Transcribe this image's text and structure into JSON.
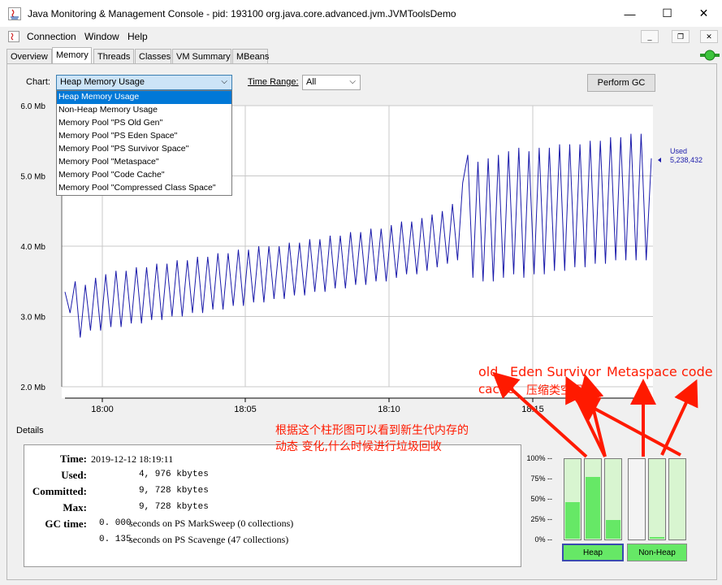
{
  "window": {
    "title": "Java Monitoring & Management Console - pid: 193100 org.java.core.advanced.jvm.JVMToolsDemo",
    "minimize": "—",
    "maximize": "☐",
    "close": "✕"
  },
  "menubar": {
    "items": [
      "Connection",
      "Window",
      "Help"
    ]
  },
  "tabs": [
    "Overview",
    "Memory",
    "Threads",
    "Classes",
    "VM Summary",
    "MBeans"
  ],
  "active_tab": "Memory",
  "toolbar": {
    "chart_label": "Chart:",
    "chart_value": "Heap Memory Usage",
    "time_range_label": "Time Range:",
    "time_range_value": "All",
    "perform_gc": "Perform GC"
  },
  "chart_dropdown": {
    "options": [
      "Heap Memory Usage",
      "Non-Heap Memory Usage",
      "Memory Pool \"PS Old Gen\"",
      "Memory Pool \"PS Eden Space\"",
      "Memory Pool \"PS Survivor Space\"",
      "Memory Pool \"Metaspace\"",
      "Memory Pool \"Code Cache\"",
      "Memory Pool \"Compressed Class Space\""
    ],
    "selected": 0
  },
  "chart_data": {
    "type": "line",
    "y_ticks": [
      "6.0 Mb",
      "5.0 Mb",
      "4.0 Mb",
      "3.0 Mb",
      "2.0 Mb"
    ],
    "ylim": [
      2.0,
      6.0
    ],
    "x_ticks": [
      "18:00",
      "18:05",
      "18:10",
      "18:15"
    ],
    "series": [
      {
        "name": "Used",
        "current_value": "5,238,432",
        "color": "#1a1aaa",
        "values": [
          3.35,
          3.05,
          3.5,
          2.7,
          3.45,
          2.8,
          3.55,
          2.8,
          3.6,
          2.85,
          3.65,
          2.85,
          3.65,
          2.9,
          3.7,
          2.9,
          3.7,
          2.95,
          3.75,
          2.95,
          3.75,
          3.0,
          3.8,
          3.0,
          3.8,
          3.05,
          3.85,
          3.05,
          3.85,
          3.1,
          3.9,
          3.1,
          3.9,
          3.15,
          3.95,
          3.15,
          3.95,
          3.2,
          4.0,
          3.2,
          4.0,
          3.25,
          4.0,
          3.25,
          4.05,
          3.3,
          4.05,
          3.3,
          4.1,
          3.35,
          4.1,
          3.35,
          4.15,
          3.4,
          4.15,
          3.4,
          4.2,
          3.45,
          4.2,
          3.45,
          4.25,
          3.5,
          4.25,
          3.5,
          4.3,
          3.55,
          4.35,
          3.6,
          4.35,
          3.6,
          4.4,
          3.65,
          4.45,
          3.7,
          4.5,
          3.75,
          4.6,
          3.8,
          4.9,
          5.3,
          3.55,
          5.2,
          3.5,
          5.25,
          3.5,
          5.3,
          3.55,
          5.35,
          3.6,
          5.4,
          3.55,
          5.35,
          3.6,
          5.4,
          3.6,
          5.4,
          3.65,
          5.45,
          3.65,
          5.45,
          3.7,
          5.45,
          3.7,
          5.5,
          3.75,
          5.5,
          3.75,
          5.55,
          3.8,
          5.55,
          3.8,
          5.6,
          3.8,
          5.6,
          3.8,
          5.25
        ]
      }
    ]
  },
  "details": {
    "heading": "Details",
    "time_label": "Time:",
    "time_value": "2019-12-12 18:19:11",
    "used_label": "Used:",
    "used_value": "4, 976 kbytes",
    "committed_label": "Committed:",
    "committed_value": "9, 728 kbytes",
    "max_label": "Max:",
    "max_value": "9, 728 kbytes",
    "gc_label": "GC time:",
    "gc1_value": "0. 000",
    "gc1_text": "seconds on PS MarkSweep (0 collections)",
    "gc2_value": "0. 135",
    "gc2_text": "seconds on PS Scavenge (47 collections)"
  },
  "bar_chart": {
    "pct_labels": [
      "100% --",
      "75% --",
      "50% --",
      "25% --",
      "0% --"
    ],
    "heap_bars": [
      0.46,
      0.78,
      0.24
    ],
    "nonheap_bars": [
      0.0,
      0.02,
      0.0
    ],
    "heap_label": "Heap",
    "nonheap_label": "Non-Heap"
  },
  "annotations": {
    "old": "old",
    "cache": "cache",
    "eden_survivor": "Eden Survivor",
    "compressed": "压缩类空间",
    "metaspace": "Metaspace",
    "code": "code",
    "note1": "根据这个柱形图可以看到新生代内存的",
    "note2": "动态 变化,什么时候进行垃圾回收"
  }
}
